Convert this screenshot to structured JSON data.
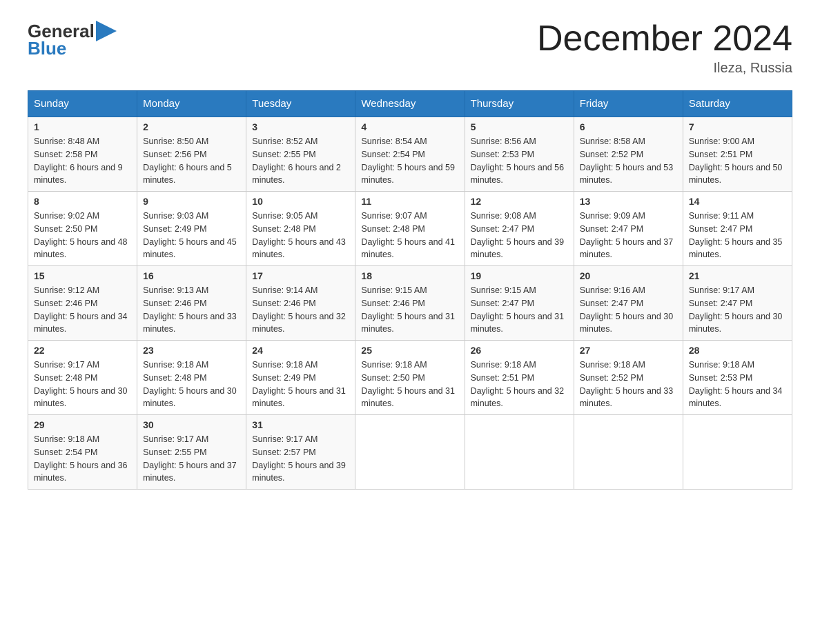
{
  "header": {
    "logo_general": "General",
    "logo_blue": "Blue",
    "month_title": "December 2024",
    "location": "Ileza, Russia"
  },
  "weekdays": [
    "Sunday",
    "Monday",
    "Tuesday",
    "Wednesday",
    "Thursday",
    "Friday",
    "Saturday"
  ],
  "weeks": [
    [
      {
        "day": "1",
        "sunrise": "8:48 AM",
        "sunset": "2:58 PM",
        "daylight": "6 hours and 9 minutes."
      },
      {
        "day": "2",
        "sunrise": "8:50 AM",
        "sunset": "2:56 PM",
        "daylight": "6 hours and 5 minutes."
      },
      {
        "day": "3",
        "sunrise": "8:52 AM",
        "sunset": "2:55 PM",
        "daylight": "6 hours and 2 minutes."
      },
      {
        "day": "4",
        "sunrise": "8:54 AM",
        "sunset": "2:54 PM",
        "daylight": "5 hours and 59 minutes."
      },
      {
        "day": "5",
        "sunrise": "8:56 AM",
        "sunset": "2:53 PM",
        "daylight": "5 hours and 56 minutes."
      },
      {
        "day": "6",
        "sunrise": "8:58 AM",
        "sunset": "2:52 PM",
        "daylight": "5 hours and 53 minutes."
      },
      {
        "day": "7",
        "sunrise": "9:00 AM",
        "sunset": "2:51 PM",
        "daylight": "5 hours and 50 minutes."
      }
    ],
    [
      {
        "day": "8",
        "sunrise": "9:02 AM",
        "sunset": "2:50 PM",
        "daylight": "5 hours and 48 minutes."
      },
      {
        "day": "9",
        "sunrise": "9:03 AM",
        "sunset": "2:49 PM",
        "daylight": "5 hours and 45 minutes."
      },
      {
        "day": "10",
        "sunrise": "9:05 AM",
        "sunset": "2:48 PM",
        "daylight": "5 hours and 43 minutes."
      },
      {
        "day": "11",
        "sunrise": "9:07 AM",
        "sunset": "2:48 PM",
        "daylight": "5 hours and 41 minutes."
      },
      {
        "day": "12",
        "sunrise": "9:08 AM",
        "sunset": "2:47 PM",
        "daylight": "5 hours and 39 minutes."
      },
      {
        "day": "13",
        "sunrise": "9:09 AM",
        "sunset": "2:47 PM",
        "daylight": "5 hours and 37 minutes."
      },
      {
        "day": "14",
        "sunrise": "9:11 AM",
        "sunset": "2:47 PM",
        "daylight": "5 hours and 35 minutes."
      }
    ],
    [
      {
        "day": "15",
        "sunrise": "9:12 AM",
        "sunset": "2:46 PM",
        "daylight": "5 hours and 34 minutes."
      },
      {
        "day": "16",
        "sunrise": "9:13 AM",
        "sunset": "2:46 PM",
        "daylight": "5 hours and 33 minutes."
      },
      {
        "day": "17",
        "sunrise": "9:14 AM",
        "sunset": "2:46 PM",
        "daylight": "5 hours and 32 minutes."
      },
      {
        "day": "18",
        "sunrise": "9:15 AM",
        "sunset": "2:46 PM",
        "daylight": "5 hours and 31 minutes."
      },
      {
        "day": "19",
        "sunrise": "9:15 AM",
        "sunset": "2:47 PM",
        "daylight": "5 hours and 31 minutes."
      },
      {
        "day": "20",
        "sunrise": "9:16 AM",
        "sunset": "2:47 PM",
        "daylight": "5 hours and 30 minutes."
      },
      {
        "day": "21",
        "sunrise": "9:17 AM",
        "sunset": "2:47 PM",
        "daylight": "5 hours and 30 minutes."
      }
    ],
    [
      {
        "day": "22",
        "sunrise": "9:17 AM",
        "sunset": "2:48 PM",
        "daylight": "5 hours and 30 minutes."
      },
      {
        "day": "23",
        "sunrise": "9:18 AM",
        "sunset": "2:48 PM",
        "daylight": "5 hours and 30 minutes."
      },
      {
        "day": "24",
        "sunrise": "9:18 AM",
        "sunset": "2:49 PM",
        "daylight": "5 hours and 31 minutes."
      },
      {
        "day": "25",
        "sunrise": "9:18 AM",
        "sunset": "2:50 PM",
        "daylight": "5 hours and 31 minutes."
      },
      {
        "day": "26",
        "sunrise": "9:18 AM",
        "sunset": "2:51 PM",
        "daylight": "5 hours and 32 minutes."
      },
      {
        "day": "27",
        "sunrise": "9:18 AM",
        "sunset": "2:52 PM",
        "daylight": "5 hours and 33 minutes."
      },
      {
        "day": "28",
        "sunrise": "9:18 AM",
        "sunset": "2:53 PM",
        "daylight": "5 hours and 34 minutes."
      }
    ],
    [
      {
        "day": "29",
        "sunrise": "9:18 AM",
        "sunset": "2:54 PM",
        "daylight": "5 hours and 36 minutes."
      },
      {
        "day": "30",
        "sunrise": "9:17 AM",
        "sunset": "2:55 PM",
        "daylight": "5 hours and 37 minutes."
      },
      {
        "day": "31",
        "sunrise": "9:17 AM",
        "sunset": "2:57 PM",
        "daylight": "5 hours and 39 minutes."
      },
      null,
      null,
      null,
      null
    ]
  ]
}
